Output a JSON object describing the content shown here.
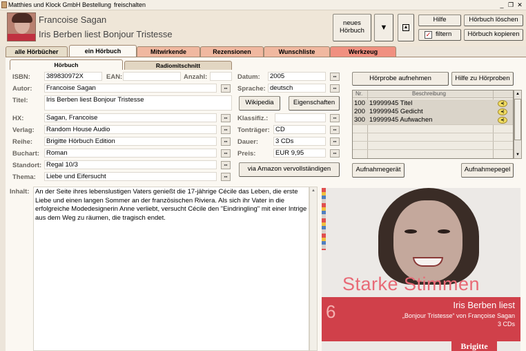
{
  "menu": {
    "company": "Matthies und Klock GmbH",
    "order": "Bestellung",
    "unlock": "freischalten"
  },
  "header": {
    "author": "Francoise Sagan",
    "title": "Iris Berben liest Bonjour Tristesse"
  },
  "toolbar": {
    "new_audiobook_line1": "neues",
    "new_audiobook_line2": "Hörbuch",
    "help": "Hilfe",
    "filter": "filtern",
    "delete": "Hörbuch löschen",
    "copy": "Hörbuch kopieren"
  },
  "main_tabs": [
    "alle Hörbücher",
    "ein Hörbuch",
    "Mitwirkende",
    "Rezensionen",
    "Wunschliste",
    "Werkzeug"
  ],
  "sub_tabs": [
    "Hörbuch",
    "Radiomitschnitt"
  ],
  "form": {
    "isbn_label": "ISBN:",
    "isbn": "389830972X",
    "ean_label": "EAN:",
    "ean": "",
    "anzahl_label": "Anzahl:",
    "anzahl": "",
    "autor_label": "Autor:",
    "autor": "Francoise Sagan",
    "titel_label": "Titel:",
    "titel": "Iris Berben liest Bonjour Tristesse",
    "hx_label": "HX:",
    "hx": "Sagan, Francoise",
    "verlag_label": "Verlag:",
    "verlag": "Random House Audio",
    "reihe_label": "Reihe:",
    "reihe": "Brigitte Hörbuch Edition",
    "buchart_label": "Buchart:",
    "buchart": "Roman",
    "standort_label": "Standort:",
    "standort": "Regal 10/3",
    "thema_label": "Thema:",
    "thema": "Liebe und Eifersucht",
    "datum_label": "Datum:",
    "datum": "2005",
    "sprache_label": "Sprache:",
    "sprache": "deutsch",
    "klassifiz_label": "Klassifiz.:",
    "klassifiz": "",
    "traeger_label": "Tonträger:",
    "traeger": "CD",
    "dauer_label": "Dauer:",
    "dauer": "3 CDs",
    "preis_label": "Preis:",
    "preis": "EUR 9,95"
  },
  "buttons": {
    "wikipedia": "Wikipedia",
    "eigenschaften": "Eigenschaften",
    "amazon": "via Amazon vervollständigen",
    "hoerprobe": "Hörprobe aufnehmen",
    "hoerprobe_help": "Hilfe zu Hörproben",
    "aufnahmegeraet": "Aufnahmegerät",
    "aufnahmepegel": "Aufnahmepegel"
  },
  "samples": {
    "col_nr": "Nr.",
    "col_desc": "Beschreibung",
    "rows": [
      {
        "nr": "100",
        "desc": "19999945 Titel"
      },
      {
        "nr": "200",
        "desc": "19999945 Gedicht"
      },
      {
        "nr": "300",
        "desc": "19999945 Aufwachen"
      }
    ]
  },
  "inhalt": {
    "label": "Inhalt:",
    "text": "An der Seite ihres lebenslustigen Vaters genießt die 17-jährige Cécile das Leben, die erste Liebe und einen langen Sommer an der französischen Riviera. Als sich ihr Vater in die erfolgreiche Modedesignerin Anne verliebt, versucht Cécile den \"Eindringling\" mit einer Intrige aus dem Weg zu räumen, die tragisch endet."
  },
  "cover": {
    "series_title": "Starke Stimmen",
    "number": "6",
    "line1": "Iris Berben liest",
    "line2": "„Bonjour Tristesse“ von Françoise Sagan",
    "line3": "3 CDs",
    "brand": "Brigitte"
  },
  "colors": {
    "accent_tab": "#f0b8a0",
    "werkzeug_tab": "#f09080",
    "cover_red": "#d0404a"
  }
}
